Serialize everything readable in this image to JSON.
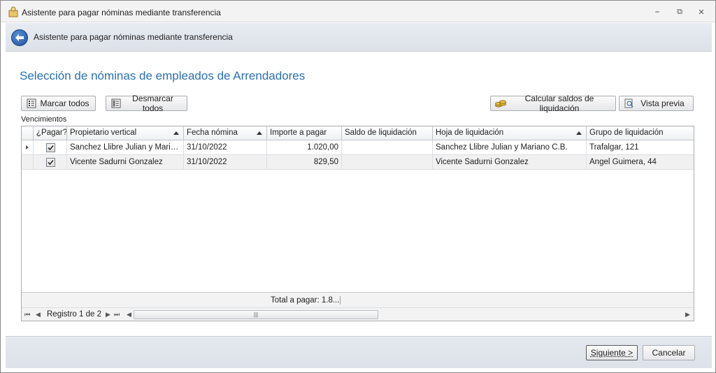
{
  "window": {
    "title": "Asistente para pagar nóminas mediante transferencia",
    "minimize": "⎯",
    "maximize": "⧉",
    "close": "✕"
  },
  "header": {
    "title": "Asistente para pagar nóminas mediante transferencia"
  },
  "main": {
    "section_title": "Selección de nóminas de empleados de Arrendadores",
    "buttons": {
      "mark_all": "Marcar todos",
      "unmark_all": "Desmarcar todos",
      "calc_balances": "Calcular saldos de liquidación",
      "preview": "Vista previa"
    },
    "grid_label": "Vencimientos"
  },
  "grid": {
    "columns": [
      "¿Pagar?",
      "Propietario vertical",
      "Fecha nómina",
      "Importe a pagar",
      "Saldo de liquidación",
      "Hoja de  liquidación",
      "Grupo de liquidación"
    ],
    "rows": [
      {
        "pay": true,
        "owner": "Sanchez Llibre Julian y Mariano C.B.",
        "date": "31/10/2022",
        "amount": "1.020,00",
        "balance": "",
        "sheet": "Sanchez Llibre Julian y Mariano C.B.",
        "group": "Trafalgar, 121"
      },
      {
        "pay": true,
        "owner": "Vicente Sadurni Gonzalez",
        "date": "31/10/2022",
        "amount": "829,50",
        "balance": "",
        "sheet": "Vicente Sadurni Gonzalez",
        "group": "Angel Guimera, 44"
      }
    ],
    "total_label": "Total a pagar: 1.8...",
    "record_label": "Registro 1 de 2",
    "scroll_grip": "|||"
  },
  "footer": {
    "next": "Siguiente >",
    "cancel": "Cancelar"
  }
}
